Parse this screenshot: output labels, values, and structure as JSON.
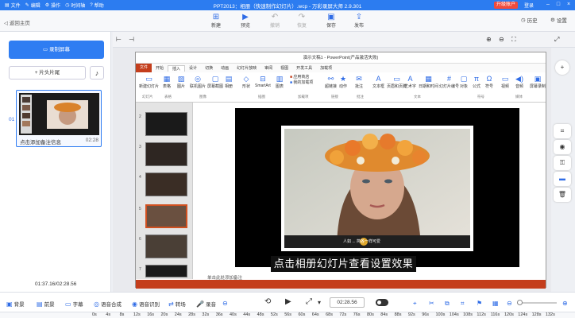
{
  "titlebar": {
    "menus": [
      "文件",
      "编辑",
      "操作",
      "时间轴",
      "帮助"
    ],
    "title": "PPT2013：相册（快速制作幻灯片）.wcp - 万彩录屏大师 2.9.301",
    "upgrade": "升级账户",
    "login": "登录",
    "accent": "#2c7cf0"
  },
  "toolbar": {
    "back": "返回主页",
    "buttons": [
      {
        "label": "新建",
        "icon": "new-icon"
      },
      {
        "label": "预览",
        "icon": "preview-icon"
      },
      {
        "label": "撤销",
        "icon": "undo-icon"
      },
      {
        "label": "恢复",
        "icon": "redo-icon"
      },
      {
        "label": "保存",
        "icon": "save-icon"
      },
      {
        "label": "发布",
        "icon": "publish-icon"
      }
    ],
    "history": "历史",
    "settings": "设置"
  },
  "left": {
    "record": "录制屏幕",
    "head_tail": "+ 片头片尾",
    "slide_index": "01",
    "thumb_caption": "点击添加备注信息",
    "thumb_time": "02:28",
    "time": "01:37.16/02:28.56"
  },
  "ppt": {
    "title": "演示文稿1 - PowerPoint(产品激活失败)",
    "tabs": [
      "文件",
      "开始",
      "插入",
      "设计",
      "切换",
      "动画",
      "幻灯片放映",
      "审阅",
      "视图",
      "开发工具",
      "加载项"
    ],
    "groups": [
      "幻灯片",
      "表格",
      "图像",
      "插图",
      "加载项",
      "链接",
      "批注",
      "文本",
      "符号",
      "媒体"
    ],
    "ribbon_items": [
      "新建幻灯片",
      "表格",
      "图片",
      "联机图片",
      "屏幕截图",
      "相册",
      "形状",
      "SmartArt",
      "图表",
      "应用商店",
      "我的加载项",
      "超链接",
      "动作",
      "批注",
      "文本框",
      "页眉和页脚",
      "艺术字",
      "日期和时间",
      "幻灯片编号",
      "对象",
      "公式",
      "符号",
      "视频",
      "音频",
      "屏幕录制"
    ],
    "slide_numbers": [
      "2",
      "3",
      "4",
      "5",
      "6",
      "7"
    ],
    "notes": "单击此处添加备注",
    "caption_hint": "人如 ... 简各一样可爱"
  },
  "subtitle": "点击相册幻灯片查看设置效果",
  "bottom": {
    "tools": [
      "背景",
      "前景",
      "字幕",
      "语音合成",
      "语音识别",
      "转场",
      "录音"
    ],
    "time": "02:28.56"
  },
  "timeline": {
    "ticks": [
      "0s",
      "4s",
      "8s",
      "12s",
      "16s",
      "20s",
      "24s",
      "28s",
      "32s",
      "36s",
      "40s",
      "44s",
      "48s",
      "52s",
      "56s",
      "60s",
      "64s",
      "68s",
      "72s",
      "76s",
      "80s",
      "84s",
      "88s",
      "92s",
      "96s",
      "100s",
      "104s",
      "108s",
      "112s",
      "116s",
      "120s",
      "124s",
      "128s",
      "132s"
    ]
  }
}
